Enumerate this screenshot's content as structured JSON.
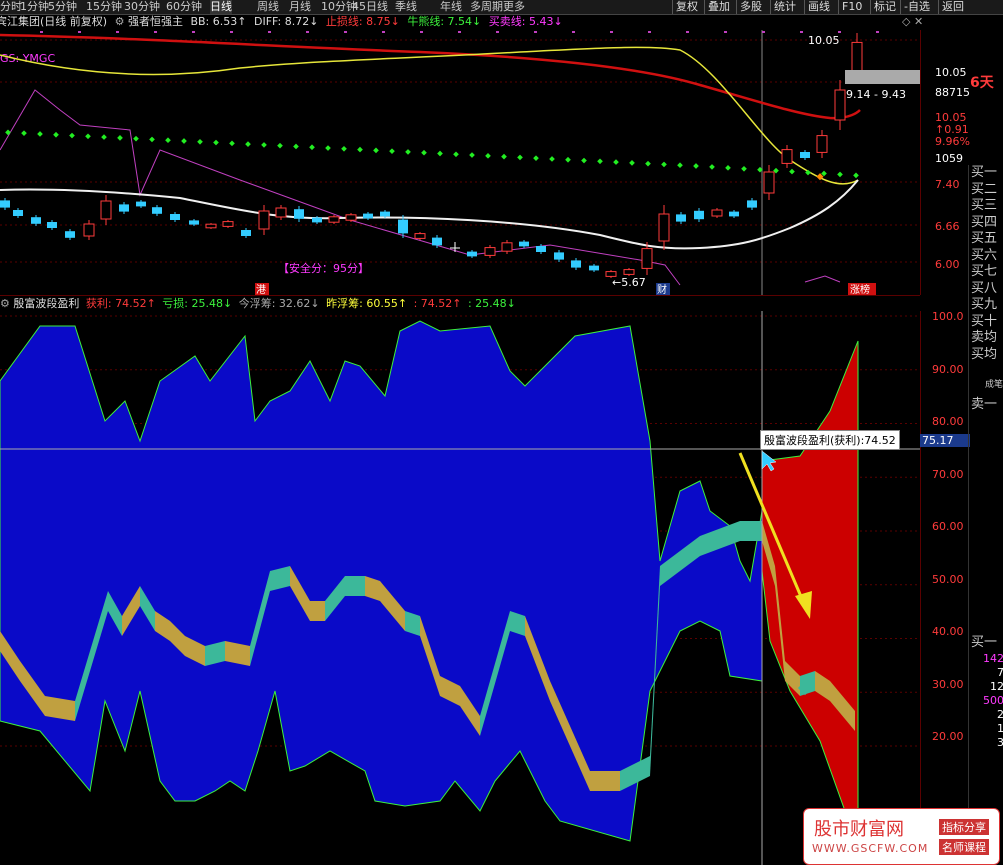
{
  "menu": {
    "left": [
      "分时",
      "1分钟",
      "5分钟",
      "15分钟",
      "30分钟",
      "60分钟",
      "日线",
      "周线",
      "月线",
      "10分钟",
      "45日线",
      "季线",
      "年线",
      "多周期",
      "更多"
    ],
    "active": "日线"
  },
  "toolbar": [
    "复权",
    "叠加",
    "多股",
    "统计",
    "画线",
    "F10",
    "标记",
    "-自选",
    "返回"
  ],
  "stock": {
    "name": "宾江集团(日线 前复权)",
    "indicator": "强者恒强主"
  },
  "main_values": [
    {
      "label": "BB: 6.53",
      "arrow": "↑",
      "color": "#ddd"
    },
    {
      "label": "DIFF: 8.72",
      "arrow": "↓",
      "color": "#ddd"
    },
    {
      "label": "止损线: 8.75",
      "arrow": "↓",
      "color": "#ff3b3b"
    },
    {
      "label": "牛熊线: 7.54",
      "arrow": "↓",
      "color": "#3cf23c"
    },
    {
      "label": "买卖线: 5.43",
      "arrow": "↓",
      "color": "#ff3bff"
    }
  ],
  "main_text": {
    "gs": "GS: YMGC",
    "safety": "【安全分：95分】",
    "low": "←5.67",
    "high": "10.05",
    "range": "9.14 - 9.43",
    "tag_gang": "港",
    "tag_cai": "财",
    "tag_zt": "涨榜"
  },
  "price_axis": [
    {
      "text": "10.05",
      "color": "#fff"
    },
    {
      "text": "88715",
      "color": "#fff"
    },
    {
      "text": "10.05",
      "color": "#ff3b3b"
    },
    {
      "text": "↑0.91",
      "color": "#ff3b3b"
    },
    {
      "text": "9.96%",
      "color": "#ff3b3b"
    },
    {
      "text": "1059",
      "color": "#fff"
    },
    {
      "text": "7.40",
      "color": "#ff3b3b"
    },
    {
      "text": "6.66",
      "color": "#ff3b3b"
    },
    {
      "text": "6.00",
      "color": "#ff3b3b"
    }
  ],
  "side_tag": "6天",
  "sub": {
    "name": "殷富波段盈利",
    "values": [
      {
        "label": "获利: 74.52",
        "arrow": "↑",
        "color": "#ff3b3b"
      },
      {
        "label": "亏损: 25.48",
        "arrow": "↓",
        "color": "#3cf23c"
      },
      {
        "label": "今浮筹: 32.62",
        "arrow": "↓",
        "color": "#aaa"
      },
      {
        "label": "昨浮筹: 60.55",
        "arrow": "↑",
        "color": "#ffff3b"
      },
      {
        "label": ": 74.52",
        "arrow": "↑",
        "color": "#ff3b3b"
      },
      {
        "label": ": 25.48",
        "arrow": "↓",
        "color": "#3cf23c"
      }
    ],
    "tooltip": "殷富波段盈利(获利):74.52",
    "cursor_value": "75.17",
    "axis": [
      "100.0",
      "90.00",
      "80.00",
      "70.00",
      "60.00",
      "50.00",
      "40.00",
      "30.00",
      "20.00"
    ]
  },
  "order_panel": {
    "buy": [
      "买一",
      "买二",
      "买三",
      "买四",
      "买五",
      "买六",
      "买七",
      "买八",
      "买九",
      "买十",
      "卖均",
      "买均"
    ],
    "small": "成笔",
    "sell1": "卖一",
    "buy1b": "买一",
    "nums": [
      "142",
      "7",
      "12",
      "500",
      "2",
      "1",
      "3"
    ]
  },
  "watermark": {
    "brand": "股市财富网",
    "url": "WWW.GSCFW.COM",
    "tag1": "指标分享",
    "tag2": "名师课程"
  },
  "colors": {
    "bg": "#000000",
    "grid": "#5a0000",
    "up": "#ff3b3b",
    "down": "#3cf",
    "blue": "#0a0ac8",
    "red": "#cc0000"
  }
}
